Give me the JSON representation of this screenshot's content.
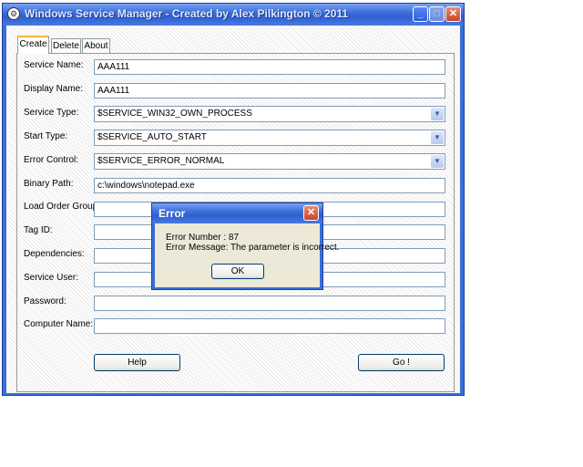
{
  "window": {
    "title": "Windows Service Manager - Created by Alex Pilkington © 2011",
    "min": "_",
    "max": "□",
    "close": "✕"
  },
  "tabs": [
    {
      "label": "Create",
      "active": true
    },
    {
      "label": "Delete",
      "active": false
    },
    {
      "label": "About",
      "active": false
    }
  ],
  "form": {
    "service_name": {
      "label": "Service Name:",
      "value": "AAA111"
    },
    "display_name": {
      "label": "Display Name:",
      "value": "AAA111"
    },
    "service_type": {
      "label": "Service Type:",
      "value": "$SERVICE_WIN32_OWN_PROCESS"
    },
    "start_type": {
      "label": "Start Type:",
      "value": "$SERVICE_AUTO_START"
    },
    "error_control": {
      "label": "Error Control:",
      "value": "$SERVICE_ERROR_NORMAL"
    },
    "binary_path": {
      "label": "Binary Path:",
      "value": "c:\\windows\\notepad.exe"
    },
    "load_order_group": {
      "label": "Load Order Group:",
      "value": ""
    },
    "tag_id": {
      "label": "Tag ID:",
      "value": ""
    },
    "dependencies": {
      "label": "Dependencies:",
      "value": ""
    },
    "service_user": {
      "label": "Service User:",
      "value": ""
    },
    "password": {
      "label": "Password:",
      "value": ""
    },
    "computer_name": {
      "label": "Computer Name:",
      "value": ""
    }
  },
  "buttons": {
    "help": "Help",
    "go": "Go !"
  },
  "dialog": {
    "title": "Error",
    "close": "✕",
    "line1": "Error Number : 87",
    "line2": "Error Message: The parameter is incorrect.",
    "ok": "OK"
  },
  "icons": {
    "dropdown": "chevron-down-icon",
    "app": "app-icon"
  },
  "colors": {
    "titlebar": "#3d6fdb",
    "tab_highlight": "#f3b63a",
    "close_button": "#c9462a"
  }
}
